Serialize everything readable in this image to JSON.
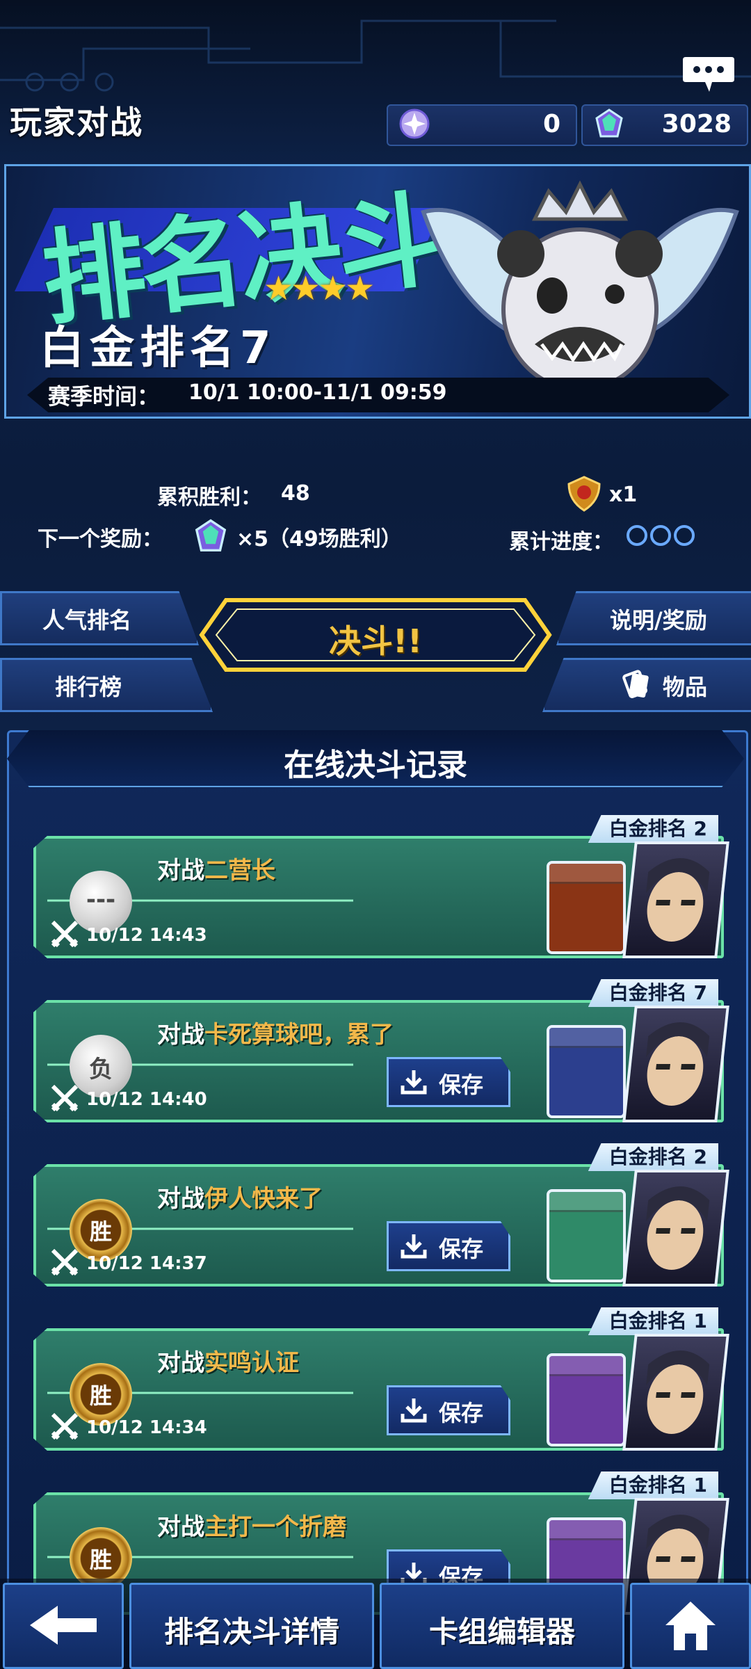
{
  "header": {
    "title": "玩家对战",
    "currency_orbs": "0",
    "currency_gems": "3028"
  },
  "banner": {
    "event_title": "排名决斗",
    "stars": "★★★★",
    "rank_name": "白金排名7",
    "season_label": "赛季时间：",
    "season_value": "10/1 10:00-11/1 09:59"
  },
  "stats": {
    "total_wins_label": "累积胜利：",
    "total_wins_value": "48",
    "next_reward_label": "下一个奖励：",
    "next_reward_value": "×5（49场胜利）",
    "token_count": "x1",
    "progress_label": "累计进度："
  },
  "menu": {
    "popular_rank": "人气排名",
    "leaderboard": "排行榜",
    "duel": "决斗!!",
    "info_rewards": "说明/奖励",
    "items": "物品"
  },
  "records": {
    "title": "在线决斗记录",
    "prefix": "对战",
    "save_label": "保存",
    "items": [
      {
        "rank": "白金排名 2",
        "opponent": "二营长",
        "time": "10/12 14:43",
        "result": "---",
        "deck_color": "#8a3415",
        "savable": false
      },
      {
        "rank": "白金排名 7",
        "opponent": "卡死算球吧，累了",
        "time": "10/12 14:40",
        "result": "负",
        "deck_color": "#2c3f8e",
        "savable": true
      },
      {
        "rank": "白金排名 2",
        "opponent": "伊人快来了",
        "time": "10/12 14:37",
        "result": "胜",
        "deck_color": "#2f8a68",
        "savable": true
      },
      {
        "rank": "白金排名 1",
        "opponent": "实鸣认证",
        "time": "10/12 14:34",
        "result": "胜",
        "deck_color": "#6a3aa0",
        "savable": true
      },
      {
        "rank": "白金排名 1",
        "opponent": "主打一个折磨",
        "time": "",
        "result": "胜",
        "deck_color": "#6a3aa0",
        "savable": true
      }
    ]
  },
  "bottom_nav": {
    "back": "back-arrow",
    "rank_details": "排名决斗详情",
    "deck_editor": "卡组编辑器",
    "home": "home"
  }
}
